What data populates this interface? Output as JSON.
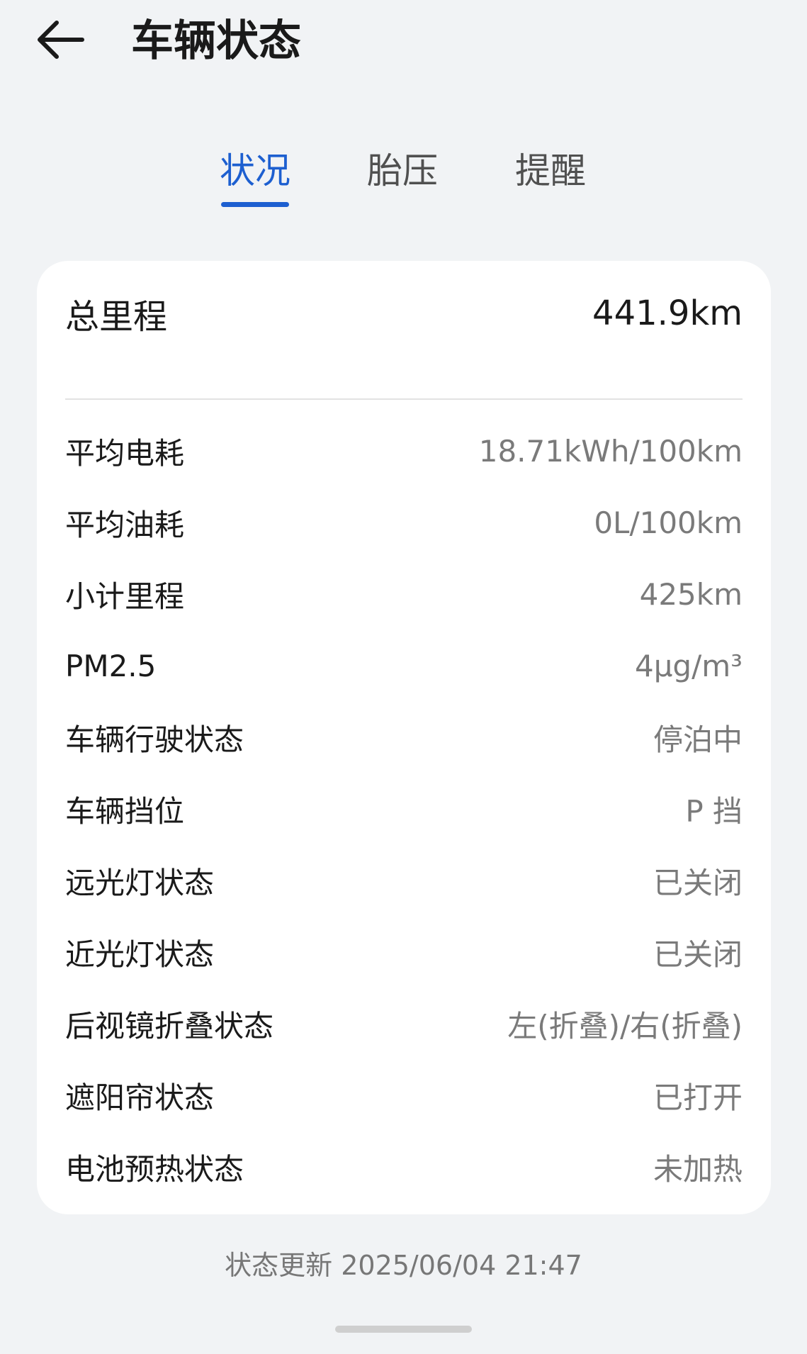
{
  "header": {
    "title": "车辆状态",
    "back_icon": "arrow-left-icon"
  },
  "tabs": [
    {
      "label": "状况",
      "active": true
    },
    {
      "label": "胎压",
      "active": false
    },
    {
      "label": "提醒",
      "active": false
    }
  ],
  "accent_color": "#1d5fd0",
  "summary": {
    "label": "总里程",
    "value": "441.9km"
  },
  "items": [
    {
      "label": "平均电耗",
      "value": "18.71kWh/100km"
    },
    {
      "label": "平均油耗",
      "value": "0L/100km"
    },
    {
      "label": "小计里程",
      "value": "425km"
    },
    {
      "label": "PM2.5",
      "value": "4μg/m³"
    },
    {
      "label": "车辆行驶状态",
      "value": "停泊中"
    },
    {
      "label": "车辆挡位",
      "value": "P 挡"
    },
    {
      "label": "远光灯状态",
      "value": "已关闭"
    },
    {
      "label": "近光灯状态",
      "value": "已关闭"
    },
    {
      "label": "后视镜折叠状态",
      "value": "左(折叠)/右(折叠)"
    },
    {
      "label": "遮阳帘状态",
      "value": "已打开"
    },
    {
      "label": "电池预热状态",
      "value": "未加热"
    }
  ],
  "footer": {
    "status_update": "状态更新 2025/06/04 21:47"
  }
}
